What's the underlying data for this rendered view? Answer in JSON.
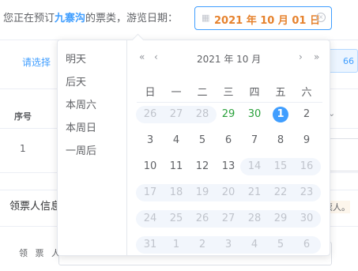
{
  "header": {
    "prefix": "您正在预订",
    "place": "九寨沟",
    "suffix": "的票类，游览日期：",
    "date_value": "2021 年 10 月 01 日",
    "date_icon": "calendar-icon",
    "clear_icon": "circle-close-icon"
  },
  "background": {
    "select_placeholder": "请选择",
    "right_button_text": "66",
    "table_header_index": "序号",
    "table_row_index": "1",
    "panel_title": "领票人信息",
    "note_text": "票人。",
    "field_label": "领 票 人"
  },
  "picker": {
    "shortcuts": [
      "明天",
      "后天",
      "本周六",
      "本周日",
      "一周后"
    ],
    "title": "2021 年  10 月",
    "nav": {
      "prev_year": "«",
      "prev_month": "‹",
      "next_month": "›",
      "next_year": "»"
    },
    "weekdays": [
      "日",
      "一",
      "二",
      "三",
      "四",
      "五",
      "六"
    ],
    "rows": [
      [
        {
          "d": "26",
          "s": "prev"
        },
        {
          "d": "27",
          "s": "prev"
        },
        {
          "d": "28",
          "s": "prev"
        },
        {
          "d": "29",
          "s": "avail"
        },
        {
          "d": "30",
          "s": "avail"
        },
        {
          "d": "1",
          "s": "today"
        },
        {
          "d": "2",
          "s": "normal"
        }
      ],
      [
        {
          "d": "3",
          "s": "normal"
        },
        {
          "d": "4",
          "s": "normal"
        },
        {
          "d": "5",
          "s": "normal"
        },
        {
          "d": "6",
          "s": "normal"
        },
        {
          "d": "7",
          "s": "normal"
        },
        {
          "d": "8",
          "s": "normal"
        },
        {
          "d": "9",
          "s": "normal"
        }
      ],
      [
        {
          "d": "10",
          "s": "normal"
        },
        {
          "d": "11",
          "s": "normal"
        },
        {
          "d": "12",
          "s": "normal"
        },
        {
          "d": "13",
          "s": "normal"
        },
        {
          "d": "14",
          "s": "disabled"
        },
        {
          "d": "15",
          "s": "disabled"
        },
        {
          "d": "16",
          "s": "disabled"
        }
      ],
      [
        {
          "d": "17",
          "s": "disabled"
        },
        {
          "d": "18",
          "s": "disabled"
        },
        {
          "d": "19",
          "s": "disabled"
        },
        {
          "d": "20",
          "s": "disabled"
        },
        {
          "d": "21",
          "s": "disabled"
        },
        {
          "d": "22",
          "s": "disabled"
        },
        {
          "d": "23",
          "s": "disabled"
        }
      ],
      [
        {
          "d": "24",
          "s": "disabled"
        },
        {
          "d": "25",
          "s": "disabled"
        },
        {
          "d": "26",
          "s": "disabled"
        },
        {
          "d": "27",
          "s": "disabled"
        },
        {
          "d": "28",
          "s": "disabled"
        },
        {
          "d": "29",
          "s": "disabled"
        },
        {
          "d": "30",
          "s": "disabled"
        }
      ],
      [
        {
          "d": "31",
          "s": "disabled"
        },
        {
          "d": "1",
          "s": "next"
        },
        {
          "d": "2",
          "s": "next"
        },
        {
          "d": "3",
          "s": "next"
        },
        {
          "d": "4",
          "s": "next"
        },
        {
          "d": "5",
          "s": "next"
        },
        {
          "d": "6",
          "s": "next"
        }
      ]
    ]
  },
  "colors": {
    "accent": "#409eff",
    "date_text": "#e6822d",
    "available": "#2aa13c",
    "disabled": "#c0c4cc",
    "disabled_bg": "#f2f6fc"
  }
}
